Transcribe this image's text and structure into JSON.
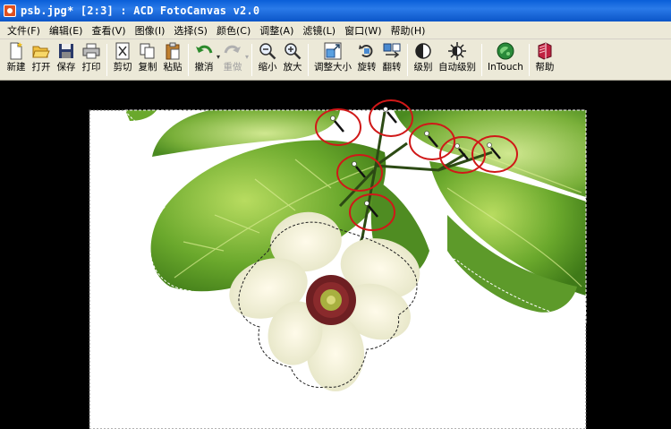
{
  "window": {
    "title": "psb.jpg* [2:3] : ACD FotoCanvas v2.0"
  },
  "menu": [
    {
      "label": "文件(F)"
    },
    {
      "label": "编辑(E)"
    },
    {
      "label": "查看(V)"
    },
    {
      "label": "图像(I)"
    },
    {
      "label": "选择(S)"
    },
    {
      "label": "颜色(C)"
    },
    {
      "label": "调整(A)"
    },
    {
      "label": "滤镜(L)"
    },
    {
      "label": "窗口(W)"
    },
    {
      "label": "帮助(H)"
    }
  ],
  "toolbar": {
    "new": "新建",
    "open": "打开",
    "save": "保存",
    "print": "打印",
    "cut": "剪切",
    "copy": "复制",
    "paste": "粘贴",
    "undo": "撤消",
    "redo": "重做",
    "zoom_out": "缩小",
    "zoom_in": "放大",
    "resize": "调整大小",
    "rotate": "旋转",
    "flip": "翻转",
    "levels": "级别",
    "auto_levels": "自动级别",
    "intouch": "InTouch",
    "help": "帮助"
  },
  "colors": {
    "titlebar": "#0a5fd8",
    "chrome": "#ece9d8",
    "annotation": "#d01818",
    "leaf": "#5a9a28",
    "flower_center": "#6e1f22"
  },
  "icons": [
    "new-icon",
    "open-icon",
    "save-icon",
    "print-icon",
    "cut-icon",
    "copy-icon",
    "paste-icon",
    "undo-icon",
    "redo-icon",
    "zoom-out-icon",
    "zoom-in-icon",
    "resize-icon",
    "rotate-icon",
    "flip-icon",
    "levels-icon",
    "auto-levels-icon",
    "intouch-icon",
    "help-icon",
    "magic-wand-icon"
  ]
}
